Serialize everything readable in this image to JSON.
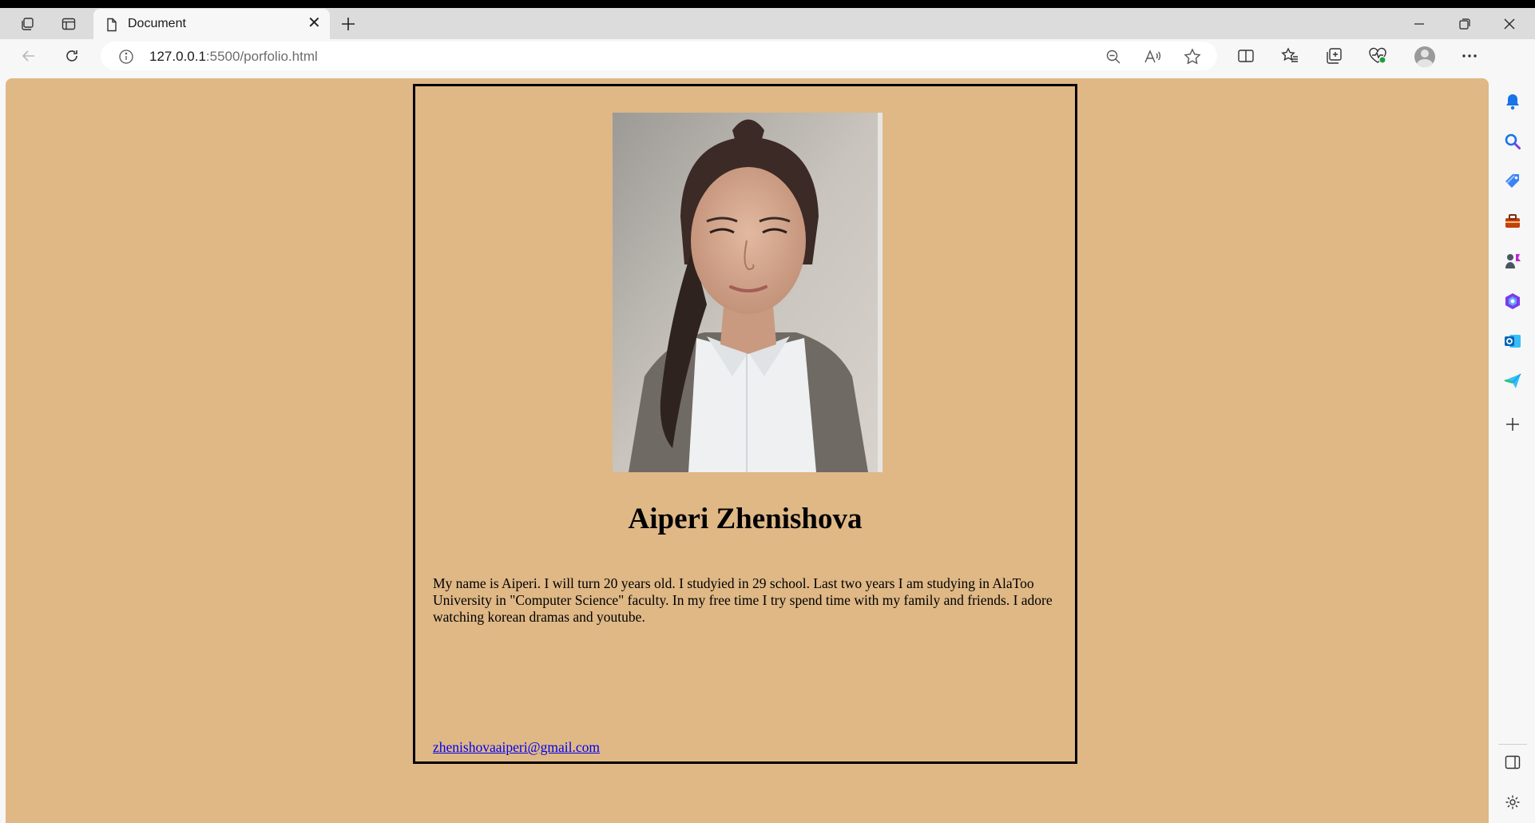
{
  "browser": {
    "tab": {
      "title": "Document"
    },
    "address": {
      "host": "127.0.0.1",
      "rest": ":5500/porfolio.html"
    }
  },
  "icons": {
    "tab_actions": "tab-actions-icon",
    "vertical_tabs": "vertical-tabs-icon",
    "page": "page-icon",
    "close": "close-icon",
    "new_tab": "plus-icon",
    "back": "back-arrow-icon",
    "refresh": "refresh-icon",
    "info": "info-icon",
    "zoom_out": "zoom-out-icon",
    "read_aloud": "read-aloud-icon",
    "favorite": "star-icon",
    "split_screen": "split-screen-icon",
    "favorites": "favorites-icon",
    "collections": "collections-icon",
    "browser_essentials": "heart-pulse-icon",
    "profile": "avatar-icon",
    "more": "more-icon",
    "copilot": "copilot-icon",
    "sidebar": [
      "bell-icon",
      "search-icon",
      "tag-icon",
      "toolbox-icon",
      "games-icon",
      "office-icon",
      "outlook-icon",
      "send-icon",
      "add-icon"
    ],
    "sidebar_bottom": [
      "sidebar-toggle-icon",
      "settings-icon"
    ]
  },
  "colors": {
    "page_bg": "#dfb886",
    "link": "#0000ee",
    "chrome": "#f7f7f7"
  },
  "page": {
    "name": "Aiperi Zhenishova",
    "bio": "My name is Aiperi. I will turn 20 years old. I studyied in 29 school. Last two years I am studying in AlaToo University in \"Computer Science\" faculty. In my free time I try spend time with my family and friends. I adore watching korean dramas and youtube.",
    "email": "zhenishovaaiperi@gmail.com"
  }
}
